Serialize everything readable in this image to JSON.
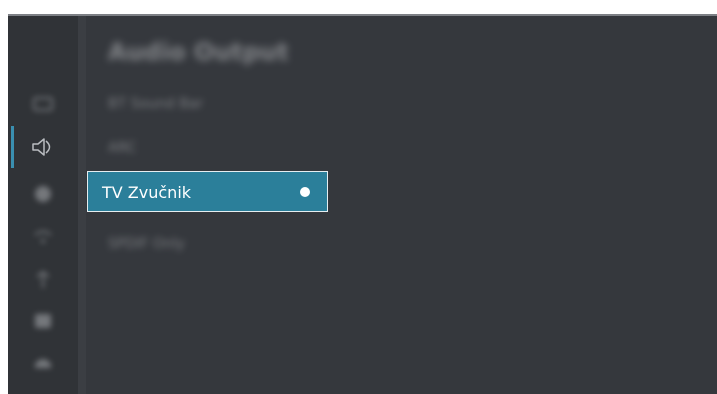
{
  "menu": {
    "title": "Audio Output",
    "items": [
      {
        "label": "BT Sound Bar",
        "state": "unselected",
        "blurred": true
      },
      {
        "label": "ARC",
        "state": "unselected",
        "blurred": true
      },
      {
        "label": "TV Zvučnik",
        "state": "selected",
        "blurred": false
      },
      {
        "label": "SPDIF Only",
        "state": "unselected",
        "blurred": true
      }
    ]
  },
  "sidebar": {
    "icons": [
      {
        "name": "picture-icon",
        "active": false
      },
      {
        "name": "sound-icon",
        "active": true
      },
      {
        "name": "channel-icon",
        "active": false
      },
      {
        "name": "network-icon",
        "active": false
      },
      {
        "name": "general-icon",
        "active": false
      },
      {
        "name": "system-icon",
        "active": false
      },
      {
        "name": "support-icon",
        "active": false
      }
    ]
  },
  "colors": {
    "background": "#35383d",
    "highlight": "#2b7f9a",
    "accent": "#3a8fb0",
    "text": "#ffffff"
  }
}
